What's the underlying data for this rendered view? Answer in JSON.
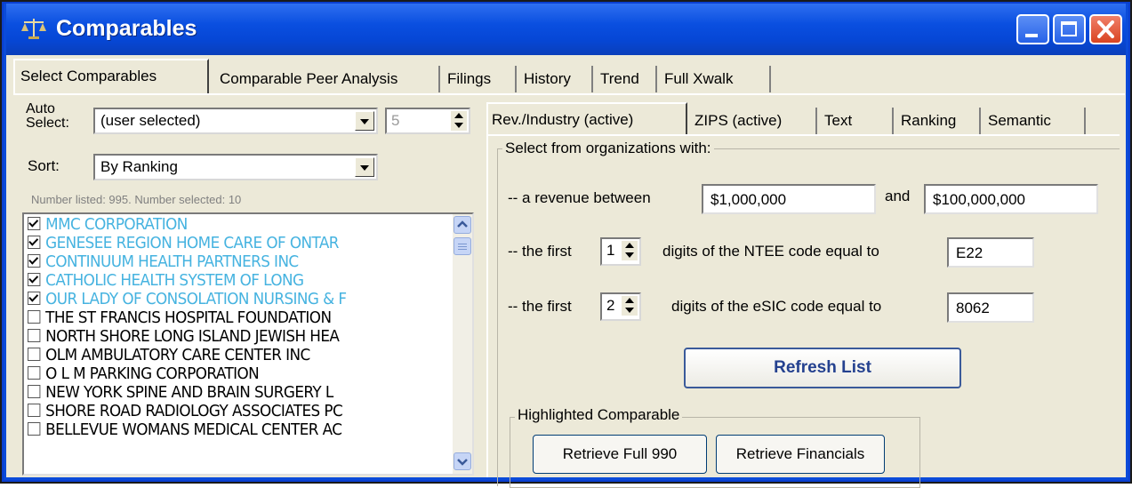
{
  "window": {
    "title": "Comparables",
    "icon": "scales-icon"
  },
  "main_tabs": [
    {
      "label": "Select Comparables",
      "active": true
    },
    {
      "label": "Comparable Peer Analysis"
    },
    {
      "label": "Filings"
    },
    {
      "label": "History"
    },
    {
      "label": "Trend"
    },
    {
      "label": "Full Xwalk"
    }
  ],
  "left": {
    "auto_select_label_1": "Auto",
    "auto_select_label_2": "Select:",
    "auto_select_value": "(user selected)",
    "auto_count": "5",
    "sort_label": "Sort:",
    "sort_value": "By Ranking",
    "info": "Number listed: 995. Number selected: 10",
    "items": [
      {
        "label": "MMC CORPORATION",
        "checked": true
      },
      {
        "label": "GENESEE REGION HOME CARE OF ONTAR",
        "checked": true
      },
      {
        "label": "CONTINUUM HEALTH PARTNERS INC",
        "checked": true
      },
      {
        "label": "CATHOLIC HEALTH SYSTEM OF LONG",
        "checked": true
      },
      {
        "label": "OUR LADY OF CONSOLATION NURSING & F",
        "checked": true
      },
      {
        "label": "THE ST FRANCIS HOSPITAL FOUNDATION",
        "checked": false
      },
      {
        "label": "NORTH SHORE LONG ISLAND JEWISH HEA",
        "checked": false
      },
      {
        "label": "OLM AMBULATORY CARE CENTER INC",
        "checked": false
      },
      {
        "label": "O L M PARKING CORPORATION",
        "checked": false
      },
      {
        "label": "NEW YORK SPINE AND BRAIN SURGERY L",
        "checked": false
      },
      {
        "label": "SHORE ROAD RADIOLOGY ASSOCIATES PC",
        "checked": false
      },
      {
        "label": "BELLEVUE WOMANS MEDICAL CENTER AC",
        "checked": false
      }
    ]
  },
  "sub_tabs": [
    {
      "label": "Rev./Industry (active)",
      "active": true
    },
    {
      "label": "ZIPS (active)"
    },
    {
      "label": "Text"
    },
    {
      "label": "Ranking"
    },
    {
      "label": "Semantic"
    }
  ],
  "filters": {
    "group_title": "Select from organizations with:",
    "revenue_label": "-- a revenue between",
    "revenue_min": "$1,000,000",
    "and_label": "and",
    "revenue_max": "$100,000,000",
    "ntee_prefix": "-- the first",
    "ntee_digits": "1",
    "ntee_suffix": "digits of the NTEE code equal to",
    "ntee_code": "E22",
    "esic_prefix": "-- the first",
    "esic_digits": "2",
    "esic_suffix": "digits of the eSIC code equal to",
    "esic_code": "8062",
    "refresh_button": "Refresh List"
  },
  "highlighted": {
    "group_title": "Highlighted Comparable",
    "retrieve_990": "Retrieve Full 990",
    "retrieve_financials": "Retrieve Financials"
  },
  "colors": {
    "titlebar": "#0a4fe0",
    "selected_item_text": "#46b3e0",
    "window_bg": "#ece9d8"
  }
}
